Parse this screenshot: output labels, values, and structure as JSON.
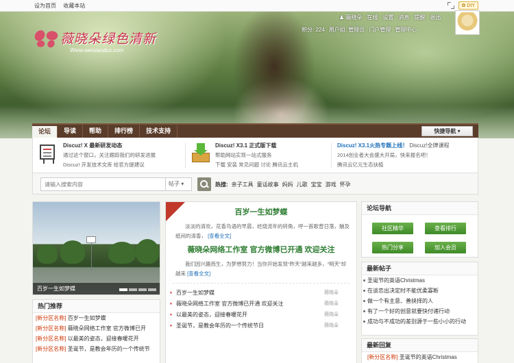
{
  "topbar": {
    "links": [
      "设为首页",
      "收藏本站"
    ],
    "diy": "DIY"
  },
  "logo": {
    "cn": "薇晓朵绿色清新",
    "en": "Www.weixiaoduo.com"
  },
  "user": {
    "name": "薇晓朵",
    "links": [
      "在线",
      "设置",
      "消息",
      "提醒",
      "退出"
    ],
    "row2": [
      "积分: 224",
      "用户组: 管理员",
      "门户管理",
      "管理中心"
    ]
  },
  "nav": {
    "items": [
      "论坛",
      "导读",
      "帮助",
      "排行榜",
      "技术支持"
    ],
    "active": 0,
    "quick": "快捷导航"
  },
  "announce": [
    {
      "title": "Discuz! X 最新研发动态",
      "lines": [
        "通过这个窗口，关注跟踪我们的研发进展",
        "Discuz! 开发技术文库   给官方提建议"
      ]
    },
    {
      "title": "Discuz! X3.1 正式版下载",
      "lines": [
        "帮助网站实现一站式服务",
        "下载  安装  常见问题  讨论  腾讯云主机"
      ]
    },
    {
      "title": "Discuz! X3.1火热专题上线！",
      "title2": "Discuz!全牌课程",
      "lines": [
        "2014创业者大会盛大开局，快来报名吧！",
        "腾讯云亿元生态扶植"
      ]
    }
  ],
  "search": {
    "placeholder": "请输入搜索内容",
    "select": "帖子",
    "hot_label": "热搜:",
    "hot": [
      "亲子工具",
      "童话故事",
      "妈妈",
      "儿歌",
      "宝宝",
      "游戏",
      "怀孕"
    ]
  },
  "slide": {
    "caption": "百岁一生如梦蝶"
  },
  "hot_recommend": {
    "title": "热门推荐",
    "items": [
      {
        "tag": "[新分区名称]",
        "text": "百岁一生如梦蝶"
      },
      {
        "tag": "[新分区名称]",
        "text": "薇晓朵网络工作室 官方微博已开"
      },
      {
        "tag": "[新分区名称]",
        "text": "以最美的姿态，迎接春暖花开"
      },
      {
        "tag": "[新分区名称]",
        "text": "圣诞节，是教会年历的一个传统节"
      }
    ]
  },
  "center": {
    "headline1": "百岁一生如梦蝶",
    "summary1": "淡淡的清欢，花香鸟语的早晨，经烧流年的转角，呼一首歌曾日落，触及纸间的清香，",
    "more1": "[查看全文]",
    "headline2": "薇晓朵网络工作室 官方微博已开通 欢迎关注",
    "summary2": "我们因兴趣而生，为梦想努力！当你开始发现“昨天”越来越多，“明天”却越来",
    "more2": "[查看全文]",
    "list": [
      {
        "text": "百岁一生如梦蝶",
        "author": "薇晓朵"
      },
      {
        "text": "薇晓朵网络工作室 官方微博已开通 欢迎关注",
        "author": "薇晓朵"
      },
      {
        "text": "以最美的姿态，迎接春暖花开",
        "author": "薇晓朵"
      },
      {
        "text": "圣诞节，是教会年历的一个传统节日",
        "author": "薇晓朵"
      }
    ]
  },
  "forum_nav": {
    "title": "论坛导航",
    "buttons": [
      "社区精华",
      "查看排行",
      "热门分享",
      "加入会员"
    ]
  },
  "new_posts": {
    "title": "最新帖子",
    "items": [
      "圣诞节的英语Christmas",
      "在谈恋出决定时不能优柔寡断",
      "做一个有主意、善抉择的人",
      "有了一个好的创意就要快付诸行动",
      "成功与不成功的差别源于一些小小的行动"
    ]
  },
  "new_replies": {
    "title": "最新回复",
    "items": [
      {
        "tag": "[新分区名称]",
        "text": "圣诞节的英语Christmas"
      }
    ]
  }
}
